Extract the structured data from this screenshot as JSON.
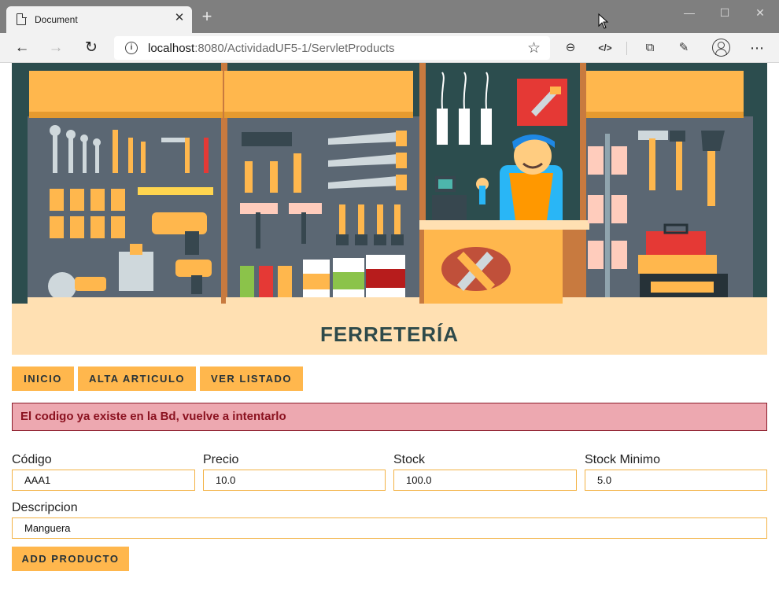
{
  "browser": {
    "tab_title": "Document",
    "url_host": "localhost",
    "url_path": ":8080/ActividadUF5-1/ServletProducts"
  },
  "header": {
    "title": "FERRETERÍA"
  },
  "nav": {
    "items": [
      {
        "label": "INICIO"
      },
      {
        "label": "ALTA ARTICULO"
      },
      {
        "label": "VER LISTADO"
      }
    ]
  },
  "alert": {
    "message": "El codigo ya existe en la Bd, vuelve a intentarlo"
  },
  "form": {
    "codigo": {
      "label": "Código",
      "value": "AAA1"
    },
    "precio": {
      "label": "Precio",
      "value": "10.0"
    },
    "stock": {
      "label": "Stock",
      "value": "100.0"
    },
    "stock_minimo": {
      "label": "Stock Minimo",
      "value": "5.0"
    },
    "descripcion": {
      "label": "Descripcion",
      "value": "Manguera"
    },
    "submit_label": "ADD PRODUCTO"
  },
  "theme": {
    "accent": "#ffb74d",
    "title_band": "#ffe0b2",
    "alert_bg": "#eda8b0",
    "alert_text": "#8b1220"
  }
}
